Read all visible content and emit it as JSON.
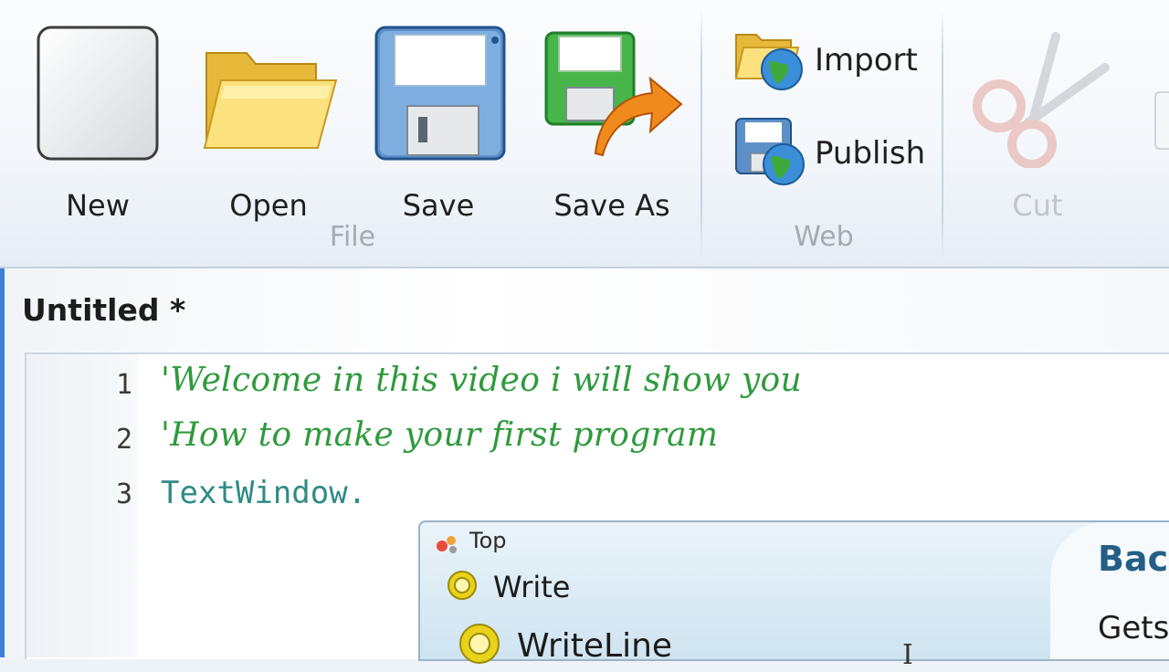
{
  "ribbon": {
    "groups": {
      "file": "File",
      "web": "Web"
    },
    "buttons": {
      "new": "New",
      "open": "Open",
      "save": "Save",
      "save_as": "Save As",
      "import": "Import",
      "publish": "Publish",
      "cut": "Cut"
    },
    "cut_disabled": true
  },
  "document": {
    "title": "Untitled *",
    "lines": [
      {
        "number": "1",
        "text": "'Welcome in this video i will show you",
        "kind": "comment"
      },
      {
        "number": "2",
        "text": "'How to make your first program",
        "kind": "comment"
      },
      {
        "number": "3",
        "text": "TextWindow.",
        "kind": "code"
      }
    ]
  },
  "intellisense": {
    "top_label": "Top",
    "items": [
      "Write",
      "WriteLine"
    ],
    "detail_title": "Bac",
    "detail_text": "Gets"
  },
  "colors": {
    "comment": "#2e9a3c",
    "code": "#2f8b86",
    "accent": "#3f7fd6"
  }
}
